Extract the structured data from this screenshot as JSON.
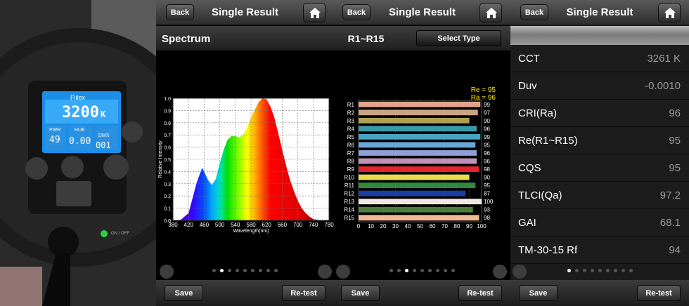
{
  "photo": {
    "brand": "Fiilex",
    "cct_value": "3200",
    "cct_unit": "K",
    "pwr_label": "PWR",
    "pwr_value": "49",
    "hue_label": "HUE",
    "hue_value": "0.00",
    "dmx_label": "DMX",
    "dmx_value": "001",
    "switch_label": "ON / OFF"
  },
  "nav": {
    "back_label": "Back",
    "title": "Single Result"
  },
  "spectrum_screen": {
    "subtitle": "Spectrum",
    "save_label": "Save",
    "retest_label": "Re-test",
    "page_count": 9,
    "active_page": 1
  },
  "cri_screen": {
    "subtitle": "R1~R15",
    "select_type_label": "Select Type",
    "save_label": "Save",
    "retest_label": "Re-test",
    "page_count": 9,
    "active_page": 2
  },
  "summary_screen": {
    "save_label": "Save",
    "retest_label": "Re-test",
    "page_count": 9,
    "active_page": 0,
    "rows": [
      {
        "label": "CCT",
        "value": "3261 K"
      },
      {
        "label": "Duv",
        "value": "-0.0010"
      },
      {
        "label": "CRI(Ra)",
        "value": "96"
      },
      {
        "label": "Re(R1~R15)",
        "value": "95"
      },
      {
        "label": "CQS",
        "value": "95"
      },
      {
        "label": "TLCI(Qa)",
        "value": "97.2"
      },
      {
        "label": "GAI",
        "value": "68.1"
      },
      {
        "label": "TM-30-15 Rf",
        "value": "94"
      }
    ]
  },
  "chart_data": [
    {
      "type": "area",
      "xlabel": "Wavelength(nm)",
      "ylabel": "Relative Intensity",
      "xlim": [
        380,
        780
      ],
      "ylim": [
        0,
        1.0
      ],
      "xticks": [
        380,
        420,
        460,
        500,
        540,
        580,
        620,
        660,
        700,
        740,
        780
      ],
      "yticks": [
        "0.0",
        "0.1",
        "0.2",
        "0.3",
        "0.4",
        "0.5",
        "0.6",
        "0.7",
        "0.8",
        "0.9",
        "1.0"
      ],
      "grid": true,
      "fill": "spectral",
      "x": [
        380,
        400,
        420,
        430,
        440,
        450,
        455,
        460,
        470,
        480,
        490,
        500,
        510,
        520,
        530,
        540,
        550,
        560,
        570,
        580,
        590,
        600,
        610,
        620,
        630,
        640,
        650,
        660,
        670,
        680,
        690,
        700,
        710,
        720,
        730,
        740,
        760,
        780
      ],
      "y": [
        0.0,
        0.005,
        0.06,
        0.18,
        0.3,
        0.39,
        0.43,
        0.4,
        0.33,
        0.29,
        0.34,
        0.47,
        0.58,
        0.66,
        0.69,
        0.69,
        0.68,
        0.7,
        0.76,
        0.84,
        0.91,
        0.97,
        1.0,
        0.99,
        0.93,
        0.84,
        0.71,
        0.58,
        0.45,
        0.33,
        0.24,
        0.16,
        0.1,
        0.06,
        0.03,
        0.01,
        0.0,
        0.0
      ]
    },
    {
      "type": "bar",
      "orientation": "horizontal",
      "header": [
        "Re = 95",
        "Ra = 96"
      ],
      "categories": [
        "R1",
        "R2",
        "R3",
        "R4",
        "R5",
        "R6",
        "R7",
        "R8",
        "R9",
        "R10",
        "R11",
        "R12",
        "R13",
        "R14",
        "R15"
      ],
      "values": [
        99,
        97,
        90,
        96,
        99,
        95,
        96,
        96,
        98,
        90,
        95,
        87,
        100,
        93,
        98
      ],
      "colors": [
        "#e3a48c",
        "#caa487",
        "#b0a255",
        "#3a9aa6",
        "#4aa3c2",
        "#6aa7d7",
        "#8fa0d8",
        "#c192b9",
        "#e0262f",
        "#e8dd4b",
        "#2f8a3f",
        "#1a3fa3",
        "#f2e8e2",
        "#4e7d3a",
        "#f1b891"
      ],
      "xlim": [
        0,
        100
      ],
      "xticks": [
        0,
        10,
        20,
        30,
        40,
        50,
        60,
        70,
        80,
        90,
        100
      ],
      "grid": true
    }
  ]
}
